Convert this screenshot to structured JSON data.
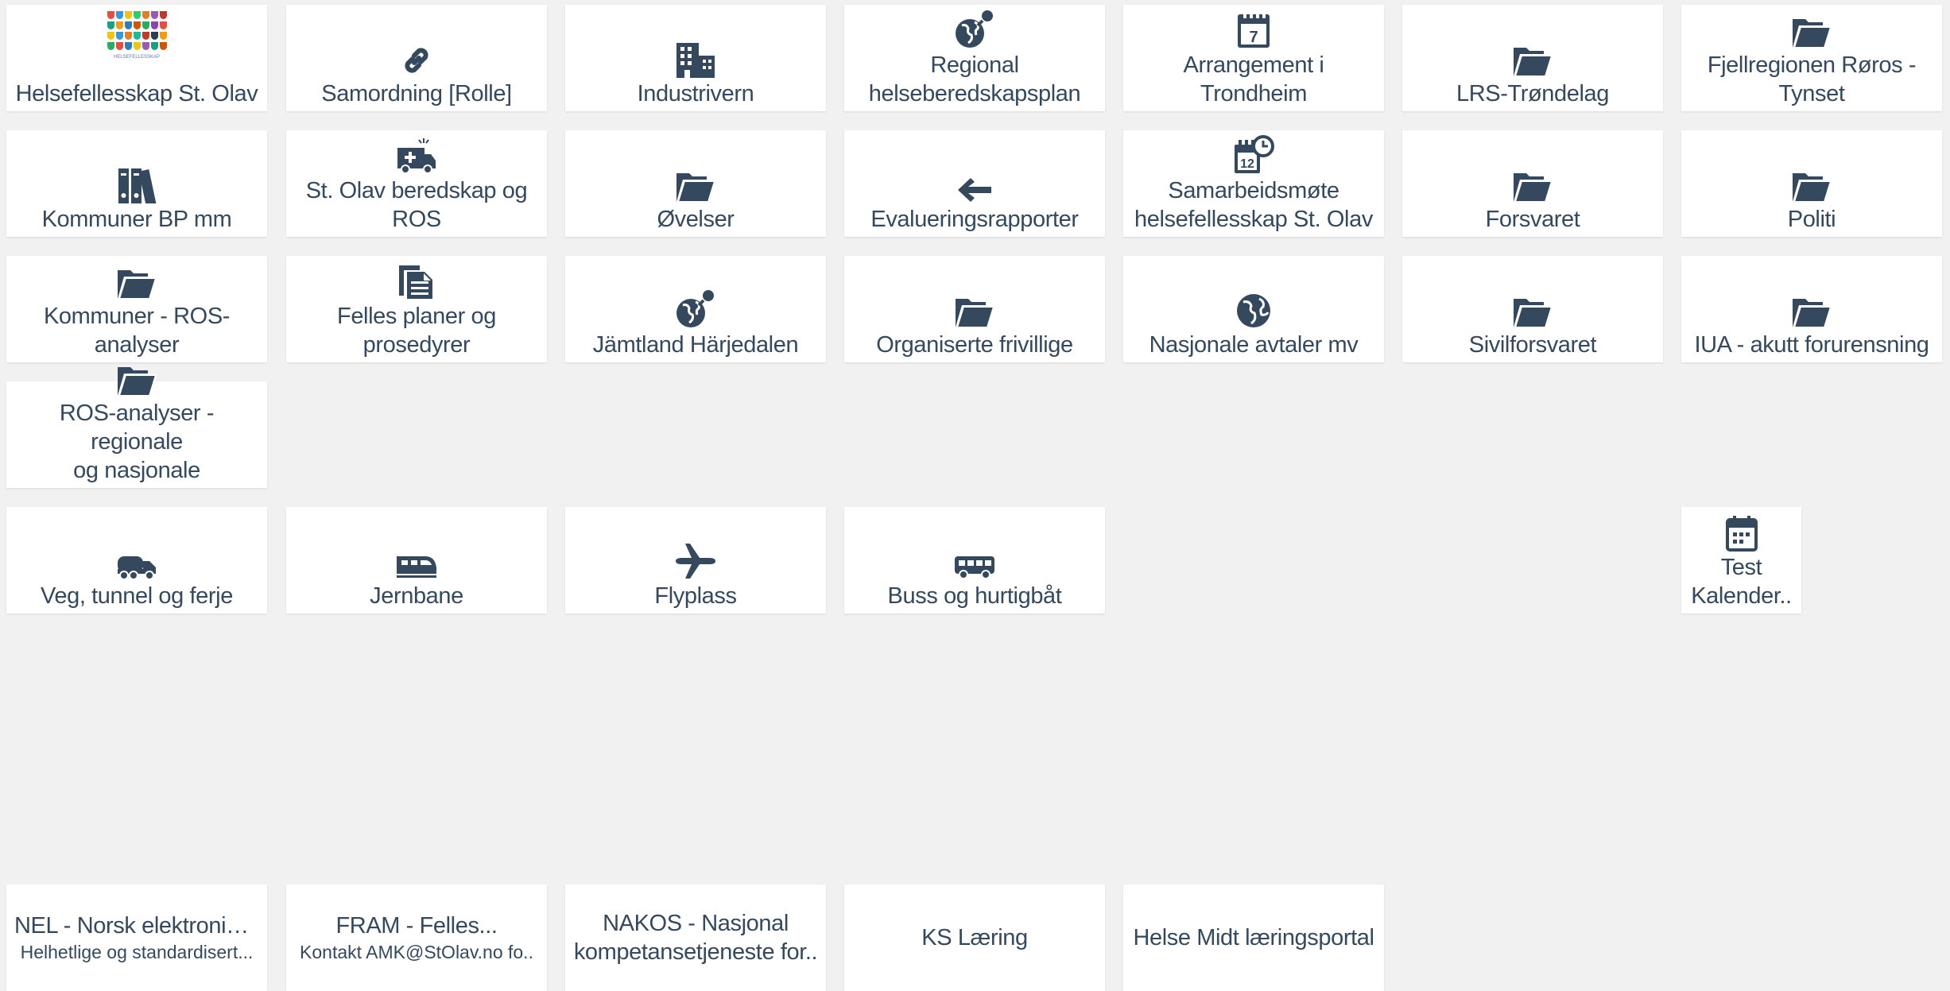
{
  "tiles": [
    {
      "label": "Helsefellesskap St. Olav",
      "icon": "logo-image"
    },
    {
      "label": "Samordning [Rolle]",
      "icon": "link-icon"
    },
    {
      "label": "Industrivern",
      "icon": "building-icon"
    },
    {
      "label": "Regional\nhelseberedskapsplan",
      "icon": "globe-pin-icon"
    },
    {
      "label": "Arrangement i Trondheim",
      "icon": "calendar-7-icon"
    },
    {
      "label": "LRS-Trøndelag",
      "icon": "folder-icon"
    },
    {
      "label": "Fjellregionen Røros -\nTynset",
      "icon": "folder-icon"
    },
    {
      "label": "Kommuner BP mm",
      "icon": "binders-icon"
    },
    {
      "label": "St. Olav beredskap og\nROS",
      "icon": "ambulance-icon"
    },
    {
      "label": "Øvelser",
      "icon": "folder-icon"
    },
    {
      "label": "Evalueringsrapporter",
      "icon": "arrow-left-icon"
    },
    {
      "label": "Samarbeidsmøte\nhelsefellesskap St. Olav",
      "icon": "calendar-clock-icon"
    },
    {
      "label": "Forsvaret",
      "icon": "folder-icon"
    },
    {
      "label": "Politi",
      "icon": "folder-icon"
    },
    {
      "label": "Kommuner - ROS-\nanalyser",
      "icon": "folder-icon"
    },
    {
      "label": "Felles planer og\nprosedyrer",
      "icon": "documents-icon"
    },
    {
      "label": "Jämtland Härjedalen",
      "icon": "globe-pin-icon"
    },
    {
      "label": "Organiserte frivillige",
      "icon": "folder-icon"
    },
    {
      "label": "Nasjonale avtaler mv",
      "icon": "globe-icon"
    },
    {
      "label": "Sivilforsvaret",
      "icon": "folder-icon"
    },
    {
      "label": "IUA - akutt forurensning",
      "icon": "folder-icon"
    },
    {
      "label": "ROS-analyser - regionale\nog nasjonale",
      "icon": "folder-icon"
    },
    {
      "label": "Veg, tunnel og ferje",
      "icon": "truck-icon"
    },
    {
      "label": "Jernbane",
      "icon": "train-icon"
    },
    {
      "label": "Flyplass",
      "icon": "airplane-icon"
    },
    {
      "label": "Buss og hurtigbåt",
      "icon": "bus-icon"
    },
    {
      "label": "Test\nKalender..",
      "icon": "calendar-icon"
    }
  ],
  "links": [
    {
      "title": "NEL - Norsk elektronisk...",
      "subtitle": "Helhetlige og standardisert..."
    },
    {
      "title": "FRAM - Felles...",
      "subtitle": "Kontakt AMK@StOlav.no fo.."
    },
    {
      "title": "NAKOS - Nasjonal\nkompetansetjeneste for..",
      "subtitle": ""
    },
    {
      "title": "KS Læring",
      "subtitle": ""
    },
    {
      "title": "Helse Midt læringsportal",
      "subtitle": ""
    }
  ],
  "logo": {
    "caption": "HELSEFELLESSKAP"
  },
  "icon_color": "#34495e",
  "background_color": "#f1f1f1"
}
